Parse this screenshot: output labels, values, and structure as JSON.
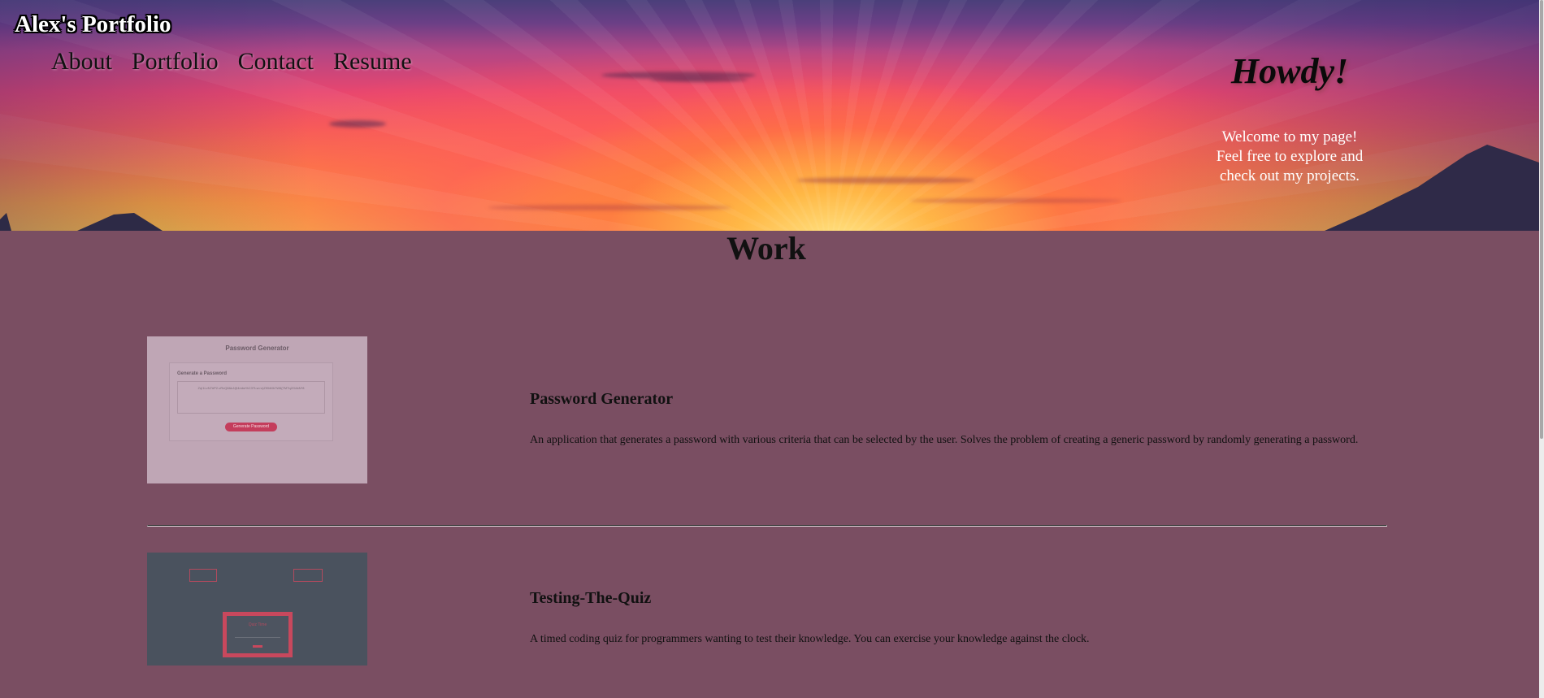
{
  "header": {
    "site_title": "Alex's Portfolio",
    "nav": [
      {
        "label": "About"
      },
      {
        "label": "Portfolio"
      },
      {
        "label": "Contact"
      },
      {
        "label": "Resume"
      }
    ],
    "greeting": "Howdy!",
    "welcome_lines": [
      "Welcome to my page!",
      "Feel free to explore and",
      "check out my projects."
    ]
  },
  "work": {
    "title": "Work",
    "projects": [
      {
        "name": "Password Generator",
        "description": "An application that generates a password with various criteria that can be selected by the user. Solves the problem of creating a generic password by randomly generating a password.",
        "thumbnail": {
          "title": "Password Generator",
          "card_heading": "Generate a Password",
          "password_text": "Zq!1LvN7#P2-vRxQ8&kJ@4mbe%C3TLw>o)Z9!bMh?W6{7MTq2G&kN*8",
          "button_label": "Generate Password"
        }
      },
      {
        "name": "Testing-The-Quiz",
        "description": "A timed coding quiz for programmers wanting to test their knowledge. You can exercise your knowledge against the clock.",
        "thumbnail": {
          "panel_title": "Quiz Time"
        }
      }
    ]
  },
  "colors": {
    "page_background": "#7a4e62",
    "accent_red": "#c43d5c",
    "text_dark": "#111111"
  }
}
